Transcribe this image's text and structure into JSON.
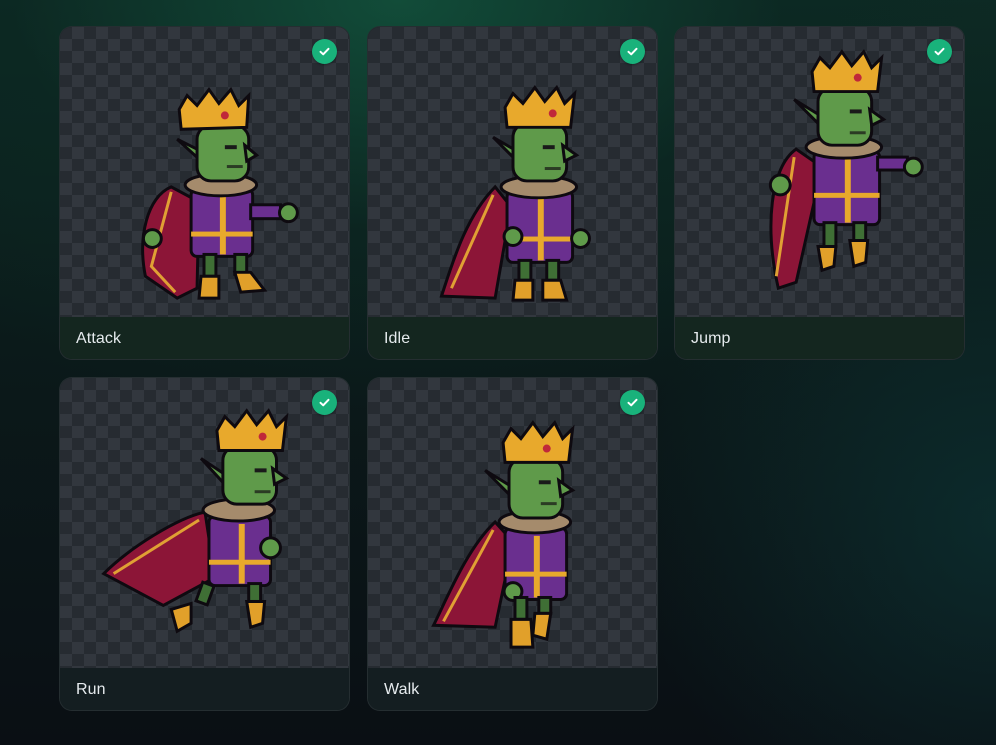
{
  "animations": [
    {
      "label": "Attack",
      "selected": true,
      "icon": "check-icon",
      "pose": "attack"
    },
    {
      "label": "Idle",
      "selected": true,
      "icon": "check-icon",
      "pose": "idle"
    },
    {
      "label": "Jump",
      "selected": true,
      "icon": "check-icon",
      "pose": "jump"
    },
    {
      "label": "Run",
      "selected": true,
      "icon": "check-icon",
      "pose": "run"
    },
    {
      "label": "Walk",
      "selected": true,
      "icon": "check-icon",
      "pose": "walk"
    }
  ],
  "colors": {
    "accent_check": "#19b27b",
    "skin": "#5f9a4a",
    "crown": "#e8a92c",
    "tunic": "#6a2f8f",
    "cape": "#8c1537",
    "fur": "#a58b6c",
    "boots": "#e1a02a"
  }
}
